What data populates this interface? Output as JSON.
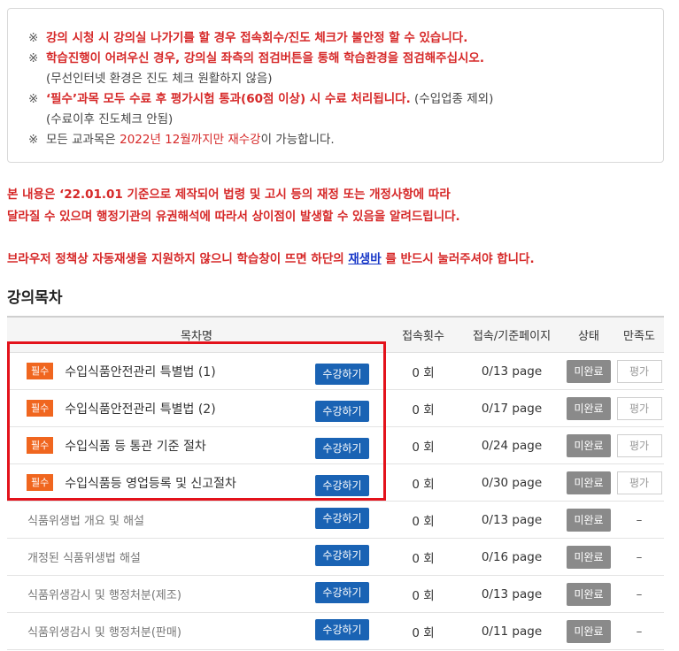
{
  "notice": {
    "mark": "※",
    "line1": "강의 시청 시 강의실 나가기를 할 경우 접속회수/진도 체크가 불안정 할 수 있습니다.",
    "line2": "학습진행이 어려우신 경우, 강의실 좌측의 점검버튼을 통해 학습환경을 점검해주십시오.",
    "line2_sub": "(무선인터넷 환경은 진도 체크 원활하지 않음)",
    "line3_red": "‘필수’과목 모두 수료 후 평가시험 통과(60점 이상) 시 수료 처리됩니다.",
    "line3_gray": " (수입업종 제외)",
    "line3_sub": "(수료이후 진도체크 안됨)",
    "line4_a": "모든 교과목은 ",
    "line4_b": "2022년 12월까지만 재수강",
    "line4_c": "이 가능합니다."
  },
  "warning": {
    "line1": "본 내용은 ‘22.01.01 기준으로 제작되어 법령 및 고시 등의 재정 또는 개정사항에 따라",
    "line2": "달라질 수 있으며 행정기관의 유권해석에 따라서 상이점이 발생할 수 있음을 알려드립니다.",
    "browser_a": "브라우저 정책상 자동재생을 지원하지 않으니 학습창이 뜨면 하단의 ",
    "browser_link": "재생바",
    "browser_b": " 를 반드시 눌러주셔야 합니다."
  },
  "section_title": "강의목차",
  "columns": [
    "목차명",
    "접속횟수",
    "접속/기준페이지",
    "상태",
    "만족도"
  ],
  "rows": [
    {
      "badge": "필수",
      "title": "수입식품안전관리 특별법 (1)",
      "button": "수강하기",
      "count": "0 회",
      "pages": "0/13 page",
      "status": "미완료",
      "rating": "평가"
    },
    {
      "badge": "필수",
      "title": "수입식품안전관리 특별법 (2)",
      "button": "수강하기",
      "count": "0 회",
      "pages": "0/17 page",
      "status": "미완료",
      "rating": "평가"
    },
    {
      "badge": "필수",
      "title": "수입식품 등 통관 기준 절차",
      "button": "수강하기",
      "count": "0 회",
      "pages": "0/24 page",
      "status": "미완료",
      "rating": "평가"
    },
    {
      "badge": "필수",
      "title": "수입식품등 영업등록 및 신고절차",
      "button": "수강하기",
      "count": "0 회",
      "pages": "0/30 page",
      "status": "미완료",
      "rating": "평가"
    },
    {
      "title": "식품위생법 개요 및 해설",
      "button": "수강하기",
      "count": "0 회",
      "pages": "0/13 page",
      "status": "미완료",
      "rating": "–"
    },
    {
      "title": "개정된 식품위생법 해설",
      "button": "수강하기",
      "count": "0 회",
      "pages": "0/16 page",
      "status": "미완료",
      "rating": "–"
    },
    {
      "title": "식품위생감시 및 행정처분(제조)",
      "button": "수강하기",
      "count": "0 회",
      "pages": "0/13 page",
      "status": "미완료",
      "rating": "–"
    },
    {
      "title": "식품위생감시 및 행정처분(판매)",
      "button": "수강하기",
      "count": "0 회",
      "pages": "0/11 page",
      "status": "미완료",
      "rating": "–"
    }
  ],
  "colors": {
    "required_badge": "#f0661f",
    "study_button": "#1a63b4",
    "status_button": "#8a8a8a",
    "warning_text": "#d62828",
    "highlight_box": "#e3121b"
  }
}
